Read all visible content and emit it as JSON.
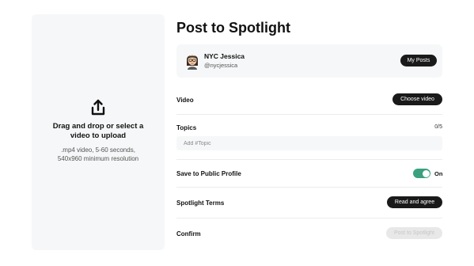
{
  "upload": {
    "title": "Drag and drop or select a video to upload",
    "hint": ".mp4 video, 5-60 seconds, 540x960 minimum resolution"
  },
  "form": {
    "title": "Post to Spotlight",
    "profile": {
      "name": "NYC Jessica",
      "handle": "@nycjessica",
      "my_posts_label": "My Posts"
    },
    "video": {
      "label": "Video",
      "button_label": "Choose video"
    },
    "topics": {
      "label": "Topics",
      "count": "0/5",
      "placeholder": "Add #Topic",
      "value": ""
    },
    "save_public": {
      "label": "Save to Public Profile",
      "state": "On",
      "enabled": true
    },
    "terms": {
      "label": "Spotlight Terms",
      "button_label": "Read and agree"
    },
    "confirm": {
      "label": "Confirm",
      "button_label": "Post to Spotlight"
    }
  },
  "colors": {
    "panel_bg": "#f6f7f8",
    "button_dark": "#1a1a1a",
    "toggle_on": "#3aa17e",
    "button_disabled": "#e8e8e8"
  },
  "icons": {
    "upload": "upload-icon",
    "avatar": "bitmoji-avatar"
  }
}
